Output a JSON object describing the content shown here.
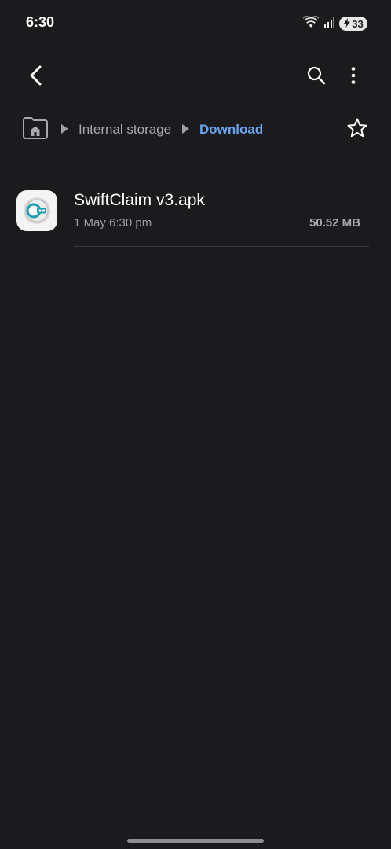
{
  "status_bar": {
    "time": "6:30",
    "battery_level": "33",
    "icons": [
      "wifi-icon",
      "signal-icon",
      "battery-saver-icon"
    ]
  },
  "app_bar": {
    "icons": [
      "back-arrow-icon",
      "search-icon",
      "more-vert-icon"
    ]
  },
  "breadcrumb": {
    "items": [
      "Internal storage",
      "Download"
    ],
    "home_icon": "home-folder-icon",
    "favorite_icon": "star-outline-icon"
  },
  "files": [
    {
      "name": "SwiftClaim v3.apk",
      "date": "1 May 6:30 pm",
      "size": "50.52 MB",
      "icon": "apk-app-icon"
    }
  ],
  "colors": {
    "background": "#1b1b1d",
    "accent": "#6aa3f0",
    "secondary_text": "#a9a9ad"
  }
}
